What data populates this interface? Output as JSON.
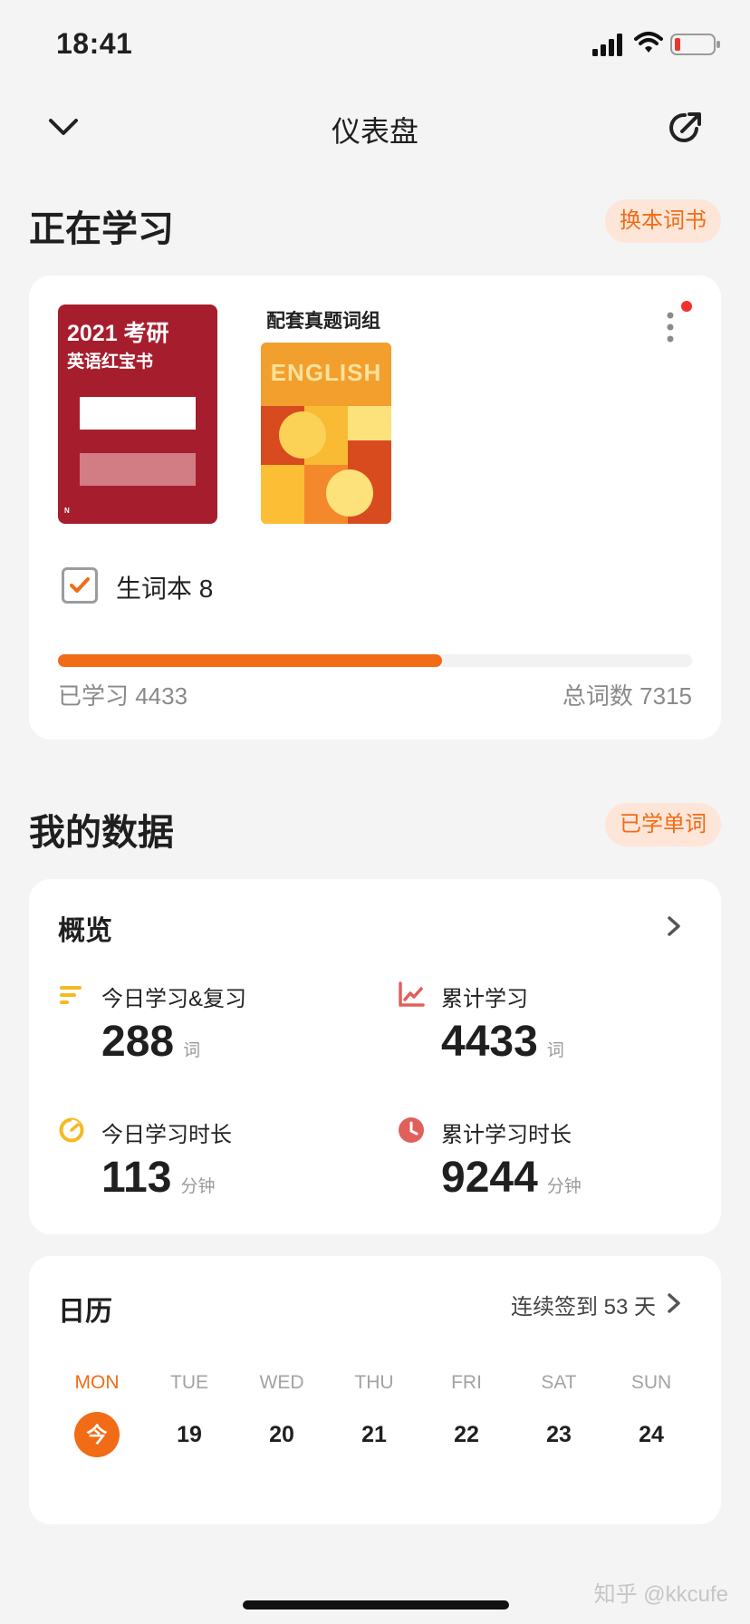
{
  "status_bar": {
    "time": "18:41",
    "icons": [
      "signal-icon",
      "wifi-icon",
      "battery-low-icon"
    ]
  },
  "nav": {
    "title": "仪表盘",
    "back_icon": "chevron-down-icon",
    "share_icon": "share-arrow-icon"
  },
  "learning": {
    "section_title": "正在学习",
    "change_book_label": "换本词书",
    "book": {
      "year_title": "2021 考研",
      "subtitle": "英语红宝书"
    },
    "companion": {
      "label": "配套真题词组",
      "cover_text": "ENGLISH"
    },
    "vocab_book_label": "生词本 8",
    "vocab_checked": true,
    "learned_text": "已学习 4433",
    "total_text": "总词数 7315",
    "progress_fraction": 0.606
  },
  "my_data": {
    "section_title": "我的数据",
    "learned_words_label": "已学单词",
    "overview": {
      "title": "概览",
      "stats": [
        {
          "label": "今日学习&复习",
          "value": "288",
          "unit": "词",
          "icon": "bars-icon",
          "color": "#f5b923"
        },
        {
          "label": "累计学习",
          "value": "4433",
          "unit": "词",
          "icon": "line-chart-icon",
          "color": "#e0605a"
        },
        {
          "label": "今日学习时长",
          "value": "113",
          "unit": "分钟",
          "icon": "timer-icon",
          "color": "#f5b923"
        },
        {
          "label": "累计学习时长",
          "value": "9244",
          "unit": "分钟",
          "icon": "clock-icon",
          "color": "#e0605a"
        }
      ]
    }
  },
  "calendar": {
    "title": "日历",
    "streak_text": "连续签到 53 天",
    "days": [
      {
        "weekday": "MON",
        "date": "今",
        "today": true
      },
      {
        "weekday": "TUE",
        "date": "19",
        "today": false
      },
      {
        "weekday": "WED",
        "date": "20",
        "today": false
      },
      {
        "weekday": "THU",
        "date": "21",
        "today": false
      },
      {
        "weekday": "FRI",
        "date": "22",
        "today": false
      },
      {
        "weekday": "SAT",
        "date": "23",
        "today": false
      },
      {
        "weekday": "SUN",
        "date": "24",
        "today": false
      }
    ]
  },
  "watermark": "知乎 @kkcufe",
  "colors": {
    "accent": "#f26b16",
    "accent_soft": "#fde6d8",
    "book_red": "#a61e2e",
    "background": "#f4f4f4"
  }
}
